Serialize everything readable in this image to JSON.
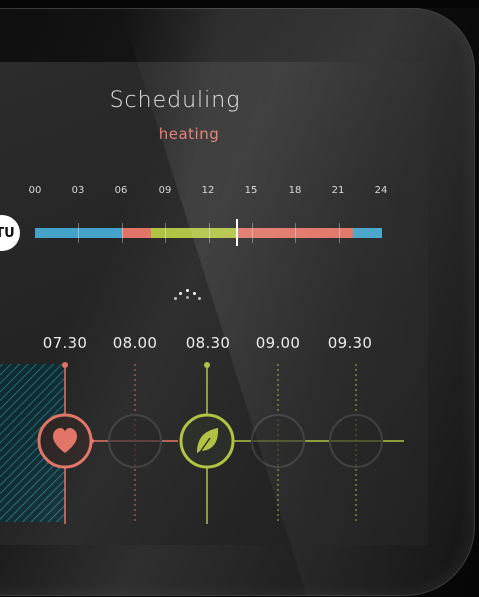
{
  "screen": {
    "title": "Scheduling",
    "subtitle": "heating"
  },
  "day_selector": {
    "label": "TU"
  },
  "hour_ticks": [
    "00",
    "03",
    "06",
    "09",
    "12",
    "15",
    "18",
    "21",
    "24"
  ],
  "schedule_bar": {
    "segments": [
      {
        "mode": "blue",
        "start": 0,
        "end": 6,
        "color": "#45a3c9"
      },
      {
        "mode": "red",
        "start": 6,
        "end": 8,
        "color": "#e07264"
      },
      {
        "mode": "green",
        "start": 8,
        "end": 14,
        "color": "#b0c13d"
      },
      {
        "mode": "red",
        "start": 14,
        "end": 22,
        "color": "#e07264"
      },
      {
        "mode": "blue",
        "start": 22,
        "end": 24,
        "color": "#45a3c9"
      }
    ],
    "current_hour": 14
  },
  "timeline": {
    "times": [
      "07.30",
      "08.00",
      "08.30",
      "09.00",
      "09.30"
    ],
    "slots": [
      {
        "icon": "heart-icon",
        "state": "active",
        "color": "#e07264"
      },
      {
        "icon": "",
        "state": "empty",
        "color": "#3a3a3a"
      },
      {
        "icon": "leaf-icon",
        "state": "active",
        "color": "#b0c13d"
      },
      {
        "icon": "",
        "state": "empty",
        "color": "#3a3a3a"
      },
      {
        "icon": "",
        "state": "empty",
        "color": "#3a3a3a"
      }
    ]
  },
  "colors": {
    "comfort": "#e07264",
    "eco": "#b0c13d",
    "night": "#45a3c9",
    "background": "#262626"
  }
}
